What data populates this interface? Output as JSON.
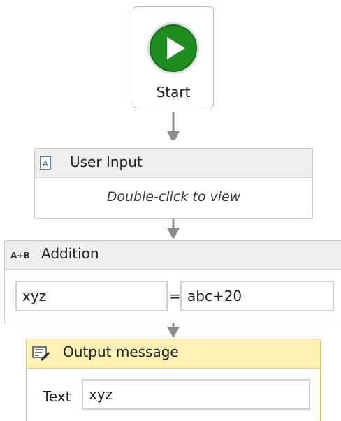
{
  "start": {
    "label": "Start",
    "icon": "play-icon",
    "color": "#1e8c1e"
  },
  "user_input": {
    "title": "User Input",
    "hint": "Double-click to view",
    "icon": "document-icon"
  },
  "addition": {
    "title": "Addition",
    "icon_text": "A+B",
    "left_value": "xyz",
    "operator": "=",
    "right_value": "abc+20"
  },
  "output_message": {
    "title": "Output message",
    "icon": "message-edit-icon",
    "text_label": "Text",
    "text_value": "xyz",
    "header_color": "#fdf2b4"
  }
}
